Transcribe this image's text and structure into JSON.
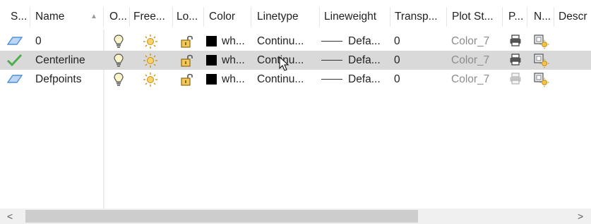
{
  "columns": {
    "status": "S...",
    "name": "Name",
    "on": "O...",
    "freeze": "Free...",
    "lock": "Lo...",
    "color": "Color",
    "linetype": "Linetype",
    "lineweight": "Lineweight",
    "transparency": "Transp...",
    "plot_style": "Plot St...",
    "plot": "P...",
    "new_vp_freeze": "N...",
    "description": "Descr"
  },
  "layers": [
    {
      "name": "0",
      "status": "layer",
      "color": "wh...",
      "linetype": "Continu...",
      "lineweight": "Defa...",
      "transparency": "0",
      "plot_style": "Color_7",
      "plottable": true,
      "selected": false
    },
    {
      "name": "Centerline",
      "status": "current",
      "color": "wh...",
      "linetype": "Continu...",
      "lineweight": "Defa...",
      "transparency": "0",
      "plot_style": "Color_7",
      "plottable": true,
      "selected": true
    },
    {
      "name": "Defpoints",
      "status": "layer",
      "color": "wh...",
      "linetype": "Continu...",
      "lineweight": "Defa...",
      "transparency": "0",
      "plot_style": "Color_7",
      "plottable": false,
      "selected": false
    }
  ],
  "scrollbar": {
    "left": "<",
    "right": ">"
  },
  "colors": {
    "selected_row": "#d9d9d9",
    "layer_icon": "#4f8fd6",
    "current_check": "#4caf50",
    "bulb": "#f2c21b",
    "sun": "#e8a92e",
    "lock": "#d4a126"
  }
}
